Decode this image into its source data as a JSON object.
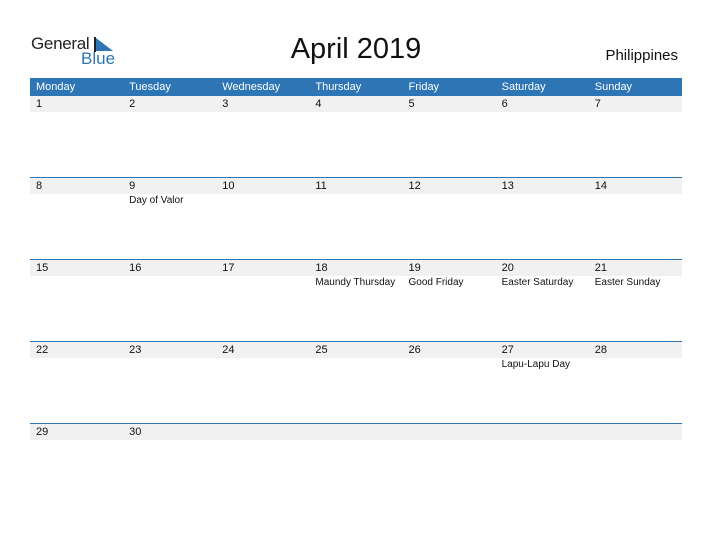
{
  "logo": {
    "general": "General",
    "blue": "Blue"
  },
  "title": "April 2019",
  "country": "Philippines",
  "colors": {
    "accent": "#2e75b6",
    "date_row_bg": "#f1f1f1"
  },
  "weekdays": [
    "Monday",
    "Tuesday",
    "Wednesday",
    "Thursday",
    "Friday",
    "Saturday",
    "Sunday"
  ],
  "weeks": [
    {
      "days": [
        "1",
        "2",
        "3",
        "4",
        "5",
        "6",
        "7"
      ],
      "events": [
        "",
        "",
        "",
        "",
        "",
        "",
        ""
      ]
    },
    {
      "days": [
        "8",
        "9",
        "10",
        "11",
        "12",
        "13",
        "14"
      ],
      "events": [
        "",
        "Day of Valor",
        "",
        "",
        "",
        "",
        ""
      ]
    },
    {
      "days": [
        "15",
        "16",
        "17",
        "18",
        "19",
        "20",
        "21"
      ],
      "events": [
        "",
        "",
        "",
        "Maundy Thursday",
        "Good Friday",
        "Easter Saturday",
        "Easter Sunday"
      ]
    },
    {
      "days": [
        "22",
        "23",
        "24",
        "25",
        "26",
        "27",
        "28"
      ],
      "events": [
        "",
        "",
        "",
        "",
        "",
        "Lapu-Lapu Day",
        ""
      ]
    },
    {
      "days": [
        "29",
        "30",
        "",
        "",
        "",
        "",
        ""
      ],
      "events": [
        "",
        "",
        "",
        "",
        "",
        "",
        ""
      ]
    }
  ]
}
